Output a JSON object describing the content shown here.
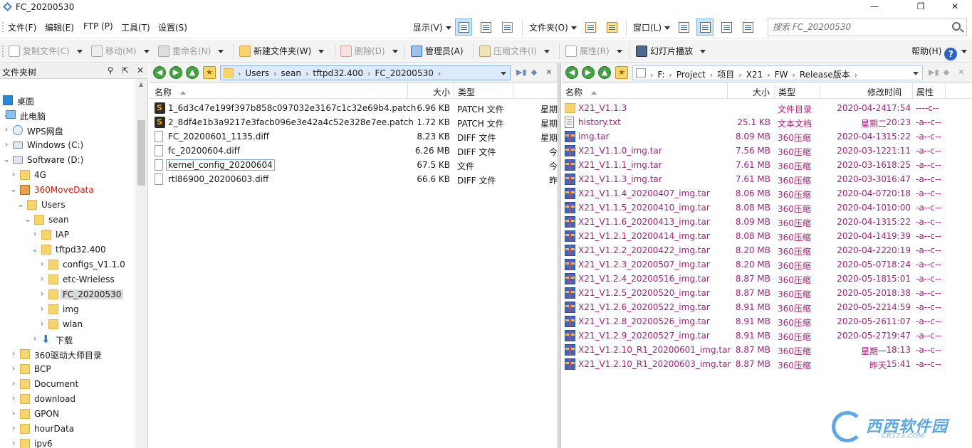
{
  "window": {
    "title": "FC_20200530"
  },
  "menu": {
    "left": [
      "文件(F)",
      "编辑(E)",
      "FTP (P)",
      "工具(T)",
      "设置(S)"
    ],
    "view_label": "显示(V)",
    "folder_label": "文件夹(O)",
    "window_label": "窗口(L)"
  },
  "search": {
    "placeholder": "搜索 FC_20200530"
  },
  "toolbar": {
    "copy": "复制文件(C)",
    "move": "移动(M)",
    "rename": "重命名(N)",
    "new_folder": "新建文件夹(W)",
    "delete": "删除(D)",
    "admin": "管理员(A)",
    "compress": "压缩文件(I)",
    "properties": "属性(R)",
    "slideshow": "幻灯片播放",
    "help": "帮助(H)",
    "help_glyph": "?"
  },
  "tree": {
    "header": "文件夹树",
    "nodes": [
      {
        "label": "桌面",
        "level": 0,
        "kind": "desktop"
      },
      {
        "label": "此电脑",
        "level": 0,
        "kind": "pc",
        "expanded": true
      },
      {
        "label": "WPS网盘",
        "level": 1,
        "kind": "cloud"
      },
      {
        "label": "Windows (C:)",
        "level": 1,
        "kind": "drive"
      },
      {
        "label": "Software (D:)",
        "level": 1,
        "kind": "drive",
        "expanded": true
      },
      {
        "label": "4G",
        "level": 2,
        "kind": "folder"
      },
      {
        "label": "360MoveData",
        "level": 2,
        "kind": "special",
        "expanded": true,
        "red": true
      },
      {
        "label": "Users",
        "level": 3,
        "kind": "folder",
        "expanded": true
      },
      {
        "label": "sean",
        "level": 4,
        "kind": "folder",
        "expanded": true
      },
      {
        "label": "IAP",
        "level": 5,
        "kind": "folder"
      },
      {
        "label": "tftpd32.400",
        "level": 5,
        "kind": "folder",
        "expanded": true
      },
      {
        "label": "configs_V1.1.0",
        "level": 6,
        "kind": "folder"
      },
      {
        "label": "etc-Wrieless",
        "level": 6,
        "kind": "folder"
      },
      {
        "label": "FC_20200530",
        "level": 6,
        "kind": "folder",
        "selected": true
      },
      {
        "label": "img",
        "level": 6,
        "kind": "folder"
      },
      {
        "label": "wlan",
        "level": 6,
        "kind": "folder"
      },
      {
        "label": "下载",
        "level": 5,
        "kind": "download"
      },
      {
        "label": "360驱动大师目录",
        "level": 2,
        "kind": "folder"
      },
      {
        "label": "BCP",
        "level": 2,
        "kind": "folder"
      },
      {
        "label": "Document",
        "level": 2,
        "kind": "folder"
      },
      {
        "label": "download",
        "level": 2,
        "kind": "folder"
      },
      {
        "label": "GPON",
        "level": 2,
        "kind": "folder"
      },
      {
        "label": "hourData",
        "level": 2,
        "kind": "folder"
      },
      {
        "label": "ipv6",
        "level": 2,
        "kind": "folder"
      }
    ]
  },
  "left_pane": {
    "path": [
      "Users",
      "sean",
      "tftpd32.400",
      "FC_20200530"
    ],
    "columns": [
      "名称",
      "大小",
      "类型"
    ],
    "files": [
      {
        "name": "1_6d3c47e199f397b858c097032e3167c1c32e69b4.patch",
        "size": "6.96 KB",
        "type": "PATCH 文件",
        "date": "星期",
        "icon": "patch"
      },
      {
        "name": "2_8df4e1b3a9217e3facb096e3e42a4c52e328e7ee.patch",
        "size": "1.72 KB",
        "type": "PATCH 文件",
        "date": "星期",
        "icon": "patch"
      },
      {
        "name": "FC_20200601_1135.diff",
        "size": "8.23 KB",
        "type": "DIFF 文件",
        "date": "星期",
        "icon": "doc"
      },
      {
        "name": "fc_20200604.diff",
        "size": "6.26 MB",
        "type": "DIFF 文件",
        "date": "今",
        "icon": "doc"
      },
      {
        "name": "kernel_config_20200604",
        "size": "67.5 KB",
        "type": "文件",
        "date": "今",
        "icon": "doc",
        "focused": true
      },
      {
        "name": "rtl86900_20200603.diff",
        "size": "66.6 KB",
        "type": "DIFF 文件",
        "date": "昨",
        "icon": "doc"
      }
    ]
  },
  "right_pane": {
    "path": [
      "F:",
      "Project",
      "项目",
      "X21",
      "FW",
      "Release版本"
    ],
    "columns": [
      "名称",
      "大小",
      "类型",
      "修改时间",
      "属性"
    ],
    "files": [
      {
        "name": "X21_V1.1.3",
        "size": "",
        "type": "文件目录",
        "date": "2020-04-24",
        "time": "17:54",
        "attr": "----c--",
        "icon": "folder"
      },
      {
        "name": "history.txt",
        "size": "25.1 KB",
        "type": "文本文档",
        "date": "星期二",
        "time": "20:23",
        "attr": "-a--c--",
        "icon": "txtf"
      },
      {
        "name": "img.tar",
        "size": "8.09 MB",
        "type": "360压缩",
        "date": "2020-04-13",
        "time": "15:22",
        "attr": "-a--c--",
        "icon": "tar"
      },
      {
        "name": "X21_V1.1.0_img.tar",
        "size": "7.56 MB",
        "type": "360压缩",
        "date": "2020-03-12",
        "time": "21:11",
        "attr": "-a--c--",
        "icon": "tar"
      },
      {
        "name": "X21_V1.1.1_img.tar",
        "size": "7.61 MB",
        "type": "360压缩",
        "date": "2020-03-16",
        "time": "18:25",
        "attr": "-a--c--",
        "icon": "tar"
      },
      {
        "name": "X21_V1.1.3_img.tar",
        "size": "7.61 MB",
        "type": "360压缩",
        "date": "2020-03-30",
        "time": "16:47",
        "attr": "-a--c--",
        "icon": "tar"
      },
      {
        "name": "X21_V1.1.4_20200407_img.tar",
        "size": "8.06 MB",
        "type": "360压缩",
        "date": "2020-04-07",
        "time": "20:18",
        "attr": "-a--c--",
        "icon": "tar"
      },
      {
        "name": "X21_V1.1.5_20200410_img.tar",
        "size": "8.08 MB",
        "type": "360压缩",
        "date": "2020-04-10",
        "time": "10:00",
        "attr": "-a--c--",
        "icon": "tar"
      },
      {
        "name": "X21_V1.1.6_20200413_img.tar",
        "size": "8.09 MB",
        "type": "360压缩",
        "date": "2020-04-13",
        "time": "15:22",
        "attr": "-a--c--",
        "icon": "tar"
      },
      {
        "name": "X21_V1.2.1_20200414_img.tar",
        "size": "8.08 MB",
        "type": "360压缩",
        "date": "2020-04-14",
        "time": "19:39",
        "attr": "-a--c--",
        "icon": "tar"
      },
      {
        "name": "X21_V1.2.2_20200422_img.tar",
        "size": "8.20 MB",
        "type": "360压缩",
        "date": "2020-04-22",
        "time": "20:19",
        "attr": "-a--c--",
        "icon": "tar"
      },
      {
        "name": "X21_V1.2.3_20200507_img.tar",
        "size": "8.20 MB",
        "type": "360压缩",
        "date": "2020-05-07",
        "time": "18:24",
        "attr": "-a--c--",
        "icon": "tar"
      },
      {
        "name": "X21_V1.2.4_20200516_img.tar",
        "size": "8.87 MB",
        "type": "360压缩",
        "date": "2020-05-18",
        "time": "15:01",
        "attr": "-a--c--",
        "icon": "tar"
      },
      {
        "name": "X21_V1.2.5_20200520_img.tar",
        "size": "8.87 MB",
        "type": "360压缩",
        "date": "2020-05-20",
        "time": "18:38",
        "attr": "-a--c--",
        "icon": "tar"
      },
      {
        "name": "X21_V1.2.6_20200522_img.tar",
        "size": "8.91 MB",
        "type": "360压缩",
        "date": "2020-05-22",
        "time": "14:59",
        "attr": "-a--c--",
        "icon": "tar"
      },
      {
        "name": "X21_V1.2.8_20200526_img.tar",
        "size": "8.91 MB",
        "type": "360压缩",
        "date": "2020-05-26",
        "time": "11:07",
        "attr": "-a--c--",
        "icon": "tar"
      },
      {
        "name": "X21_V1.2.9_20200527_img.tar",
        "size": "8.91 MB",
        "type": "360压缩",
        "date": "2020-05-27",
        "time": "19:47",
        "attr": "-a--c--",
        "icon": "tar"
      },
      {
        "name": "X21_V1.2.10_R1_20200601_img.tar",
        "size": "8.87 MB",
        "type": "360压缩",
        "date": "星期一",
        "time": "18:13",
        "attr": "-a--c--",
        "icon": "tar"
      },
      {
        "name": "X21_V1.2.10_R1_20200603_img.tar",
        "size": "8.87 MB",
        "type": "360压缩",
        "date": "昨天",
        "time": "15:41",
        "attr": "-a--c--",
        "icon": "tar"
      }
    ]
  },
  "watermark": {
    "main": "西西软件园",
    "sub": "CR173.COM"
  },
  "colors": {
    "accent_text": "#b0207a",
    "red_node": "#d81e06",
    "selection": "#cce4f7"
  }
}
